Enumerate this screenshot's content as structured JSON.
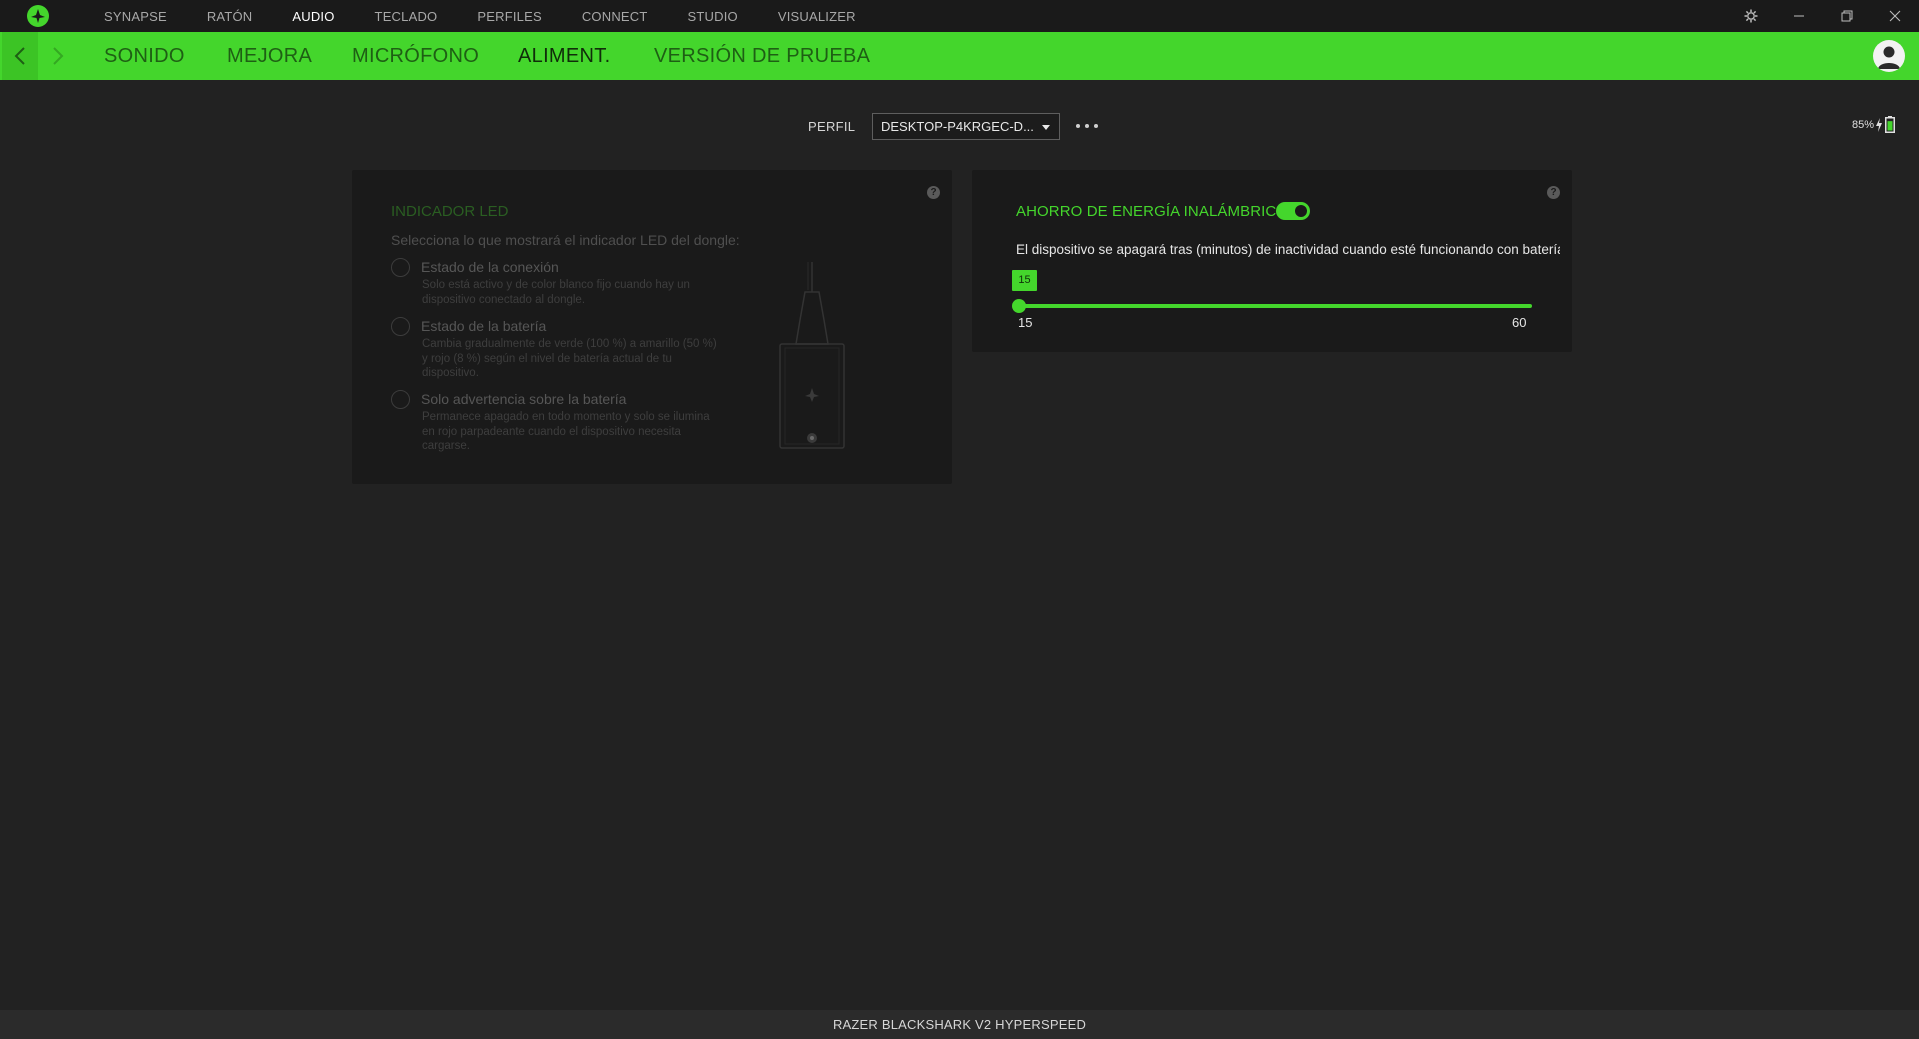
{
  "topnav": {
    "items": [
      "SYNAPSE",
      "RATÓN",
      "AUDIO",
      "TECLADO",
      "PERFILES",
      "CONNECT",
      "STUDIO",
      "VISUALIZER"
    ],
    "active": "AUDIO"
  },
  "subnav": {
    "tabs": [
      "SONIDO",
      "MEJORA",
      "MICRÓFONO",
      "ALIMENT.",
      "VERSIÓN DE PRUEBA"
    ],
    "active": "ALIMENT."
  },
  "profile": {
    "label": "PERFIL",
    "value": "DESKTOP-P4KRGEC-D..."
  },
  "battery": {
    "percent": "85%",
    "level": 0.85,
    "charging": true
  },
  "led_panel": {
    "title": "INDICADOR LED",
    "description": "Selecciona lo que mostrará el indicador LED del dongle:",
    "options": [
      {
        "title": "Estado de la conexión",
        "text": "Solo está activo y de color blanco fijo cuando hay un dispositivo conectado al dongle."
      },
      {
        "title": "Estado de la batería",
        "text": "Cambia gradualmente de verde (100 %) a amarillo (50 %) y rojo (8 %) según el nivel de batería actual de tu dispositivo."
      },
      {
        "title": "Solo advertencia sobre la batería",
        "text": "Permanece apagado en todo momento y solo se ilumina en rojo parpadeante cuando el dispositivo necesita cargarse."
      }
    ],
    "help": "?"
  },
  "power_panel": {
    "title": "AHORRO DE ENERGÍA INALÁMBRICO",
    "toggle_on": true,
    "description": "El dispositivo se apagará tras (minutos) de inactividad cuando esté funcionando con batería",
    "slider": {
      "value": "15",
      "min": "15",
      "max": "60"
    },
    "help": "?"
  },
  "footer": {
    "device": "RAZER BLACKSHARK V2 HYPERSPEED"
  },
  "colors": {
    "accent": "#44d62c",
    "background": "#222222",
    "panel": "#1a1a1a"
  },
  "icons": [
    "razer-logo-icon",
    "settings-icon",
    "minimize-icon",
    "restore-icon",
    "close-icon",
    "chevron-left-icon",
    "chevron-right-icon",
    "account-icon",
    "more-icon",
    "battery-icon",
    "bolt-icon",
    "help-icon",
    "dropdown-caret-icon"
  ]
}
